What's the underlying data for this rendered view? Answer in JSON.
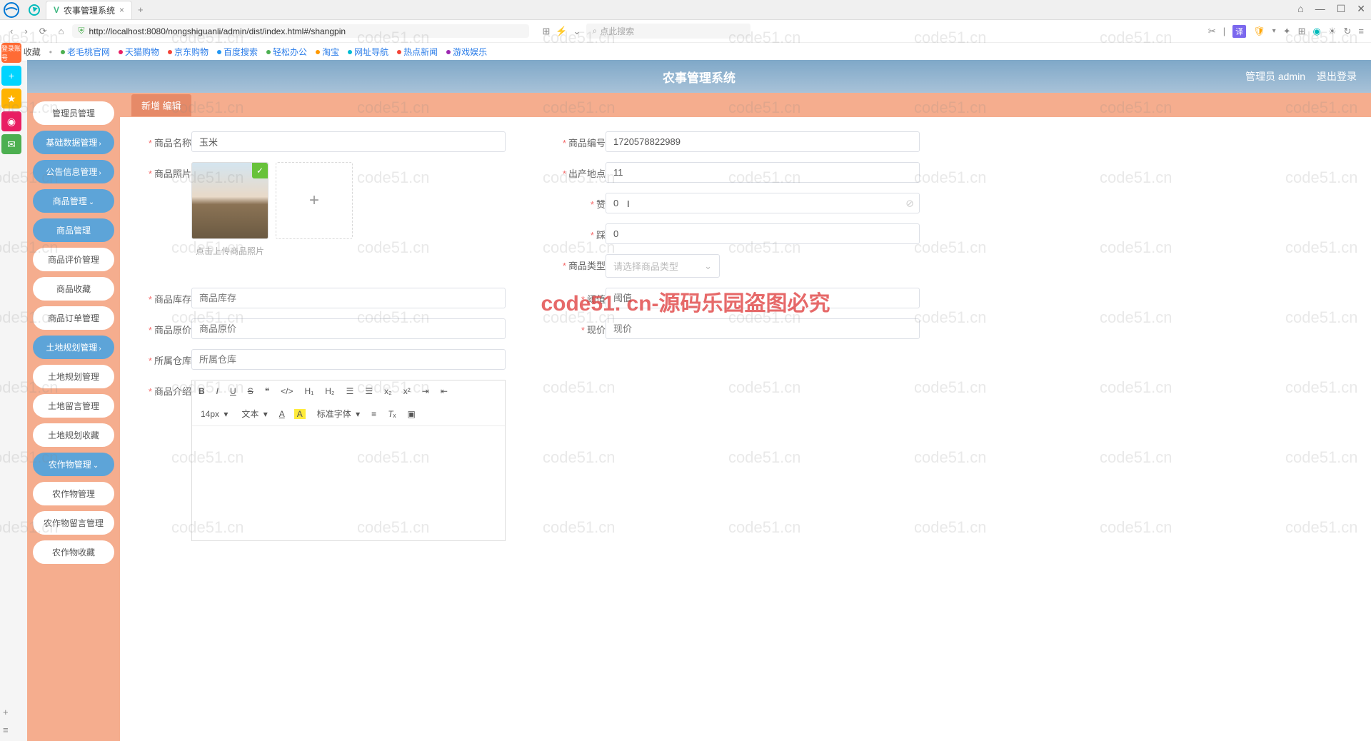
{
  "browser": {
    "tab_title": "农事管理系统",
    "url_text": "http://localhost:8080/nongshiguanli/admin/dist/index.html#/shangpin",
    "search_placeholder": "点此搜索",
    "window_controls": {
      "min": "—",
      "max": "☐",
      "close": "✕",
      "extra": "⌂"
    }
  },
  "bookmarks": {
    "fav_label": "收藏",
    "items": [
      "老毛桃官网",
      "天猫购物",
      "京东购物",
      "百度搜索",
      "轻松办公",
      "淘宝",
      "网址导航",
      "热点新闻",
      "游戏娱乐"
    ]
  },
  "header": {
    "title": "农事管理系统",
    "user_label": "管理员 admin",
    "logout": "退出登录"
  },
  "sidebar": [
    {
      "label": "管理员管理",
      "type": "item"
    },
    {
      "label": "基础数据管理",
      "type": "group",
      "caret": "›"
    },
    {
      "label": "公告信息管理",
      "type": "group",
      "caret": "›"
    },
    {
      "label": "商品管理",
      "type": "group",
      "caret": "⌄"
    },
    {
      "label": "商品管理",
      "type": "active"
    },
    {
      "label": "商品评价管理",
      "type": "item"
    },
    {
      "label": "商品收藏",
      "type": "item"
    },
    {
      "label": "商品订单管理",
      "type": "item"
    },
    {
      "label": "土地规划管理",
      "type": "group",
      "caret": "›"
    },
    {
      "label": "土地规划管理",
      "type": "item"
    },
    {
      "label": "土地留言管理",
      "type": "item"
    },
    {
      "label": "土地规划收藏",
      "type": "item"
    },
    {
      "label": "农作物管理",
      "type": "group",
      "caret": "⌄"
    },
    {
      "label": "农作物管理",
      "type": "item"
    },
    {
      "label": "农作物留言管理",
      "type": "item"
    },
    {
      "label": "农作物收藏",
      "type": "item"
    }
  ],
  "content": {
    "tab_label": "新增 编辑",
    "form": {
      "name_label": "商品名称",
      "name_value": "玉米",
      "id_label": "商品编号",
      "id_value": "1720578822989",
      "photo_label": "商品照片",
      "photo_tip": "点击上传商品照片",
      "origin_label": "出产地点",
      "origin_value": "11",
      "zan_label": "赞",
      "zan_value": "0",
      "cai_label": "踩",
      "cai_value": "0",
      "type_label": "商品类型",
      "type_placeholder": "请选择商品类型",
      "stock_label": "商品库存",
      "stock_placeholder": "商品库存",
      "threshold_label": "阈值",
      "threshold_placeholder": "阈值",
      "origprice_label": "商品原价",
      "origprice_placeholder": "商品原价",
      "price_label": "现价",
      "price_placeholder": "现价",
      "warehouse_label": "所属仓库",
      "warehouse_placeholder": "所属仓库",
      "intro_label": "商品介绍"
    },
    "editor": {
      "font_size": "14px",
      "text_label": "文本",
      "font_label": "标准字体"
    }
  },
  "watermark": {
    "text": "code51.cn",
    "big": "code51. cn-源码乐园盗图必究"
  }
}
